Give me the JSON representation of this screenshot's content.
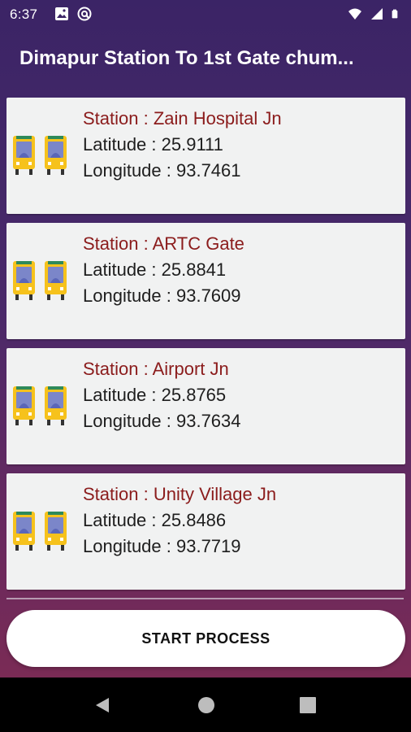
{
  "status_bar": {
    "time": "6:37",
    "icons_left": [
      "gallery-icon",
      "at-sign-icon"
    ],
    "icons_right": [
      "wifi-icon",
      "signal-icon",
      "battery-icon"
    ]
  },
  "app_bar": {
    "title": "Dimapur Station To 1st Gate chum..."
  },
  "stations": [
    {
      "station": "Station : Zain Hospital Jn",
      "latitude": "Latitude : 25.9111",
      "longitude": "Longitude : 93.7461"
    },
    {
      "station": "Station : ARTC Gate",
      "latitude": "Latitude : 25.8841",
      "longitude": "Longitude : 93.7609"
    },
    {
      "station": "Station : Airport Jn",
      "latitude": "Latitude : 25.8765",
      "longitude": "Longitude : 93.7634"
    },
    {
      "station": "Station : Unity Village Jn",
      "latitude": "Latitude : 25.8486",
      "longitude": "Longitude : 93.7719"
    }
  ],
  "actions": {
    "start_label": "START PROCESS"
  },
  "colors": {
    "station_text": "#8b1c1c",
    "card_bg": "#f1f2f2",
    "bus_yellow": "#f6c21c",
    "bus_window": "#7b86c9"
  }
}
